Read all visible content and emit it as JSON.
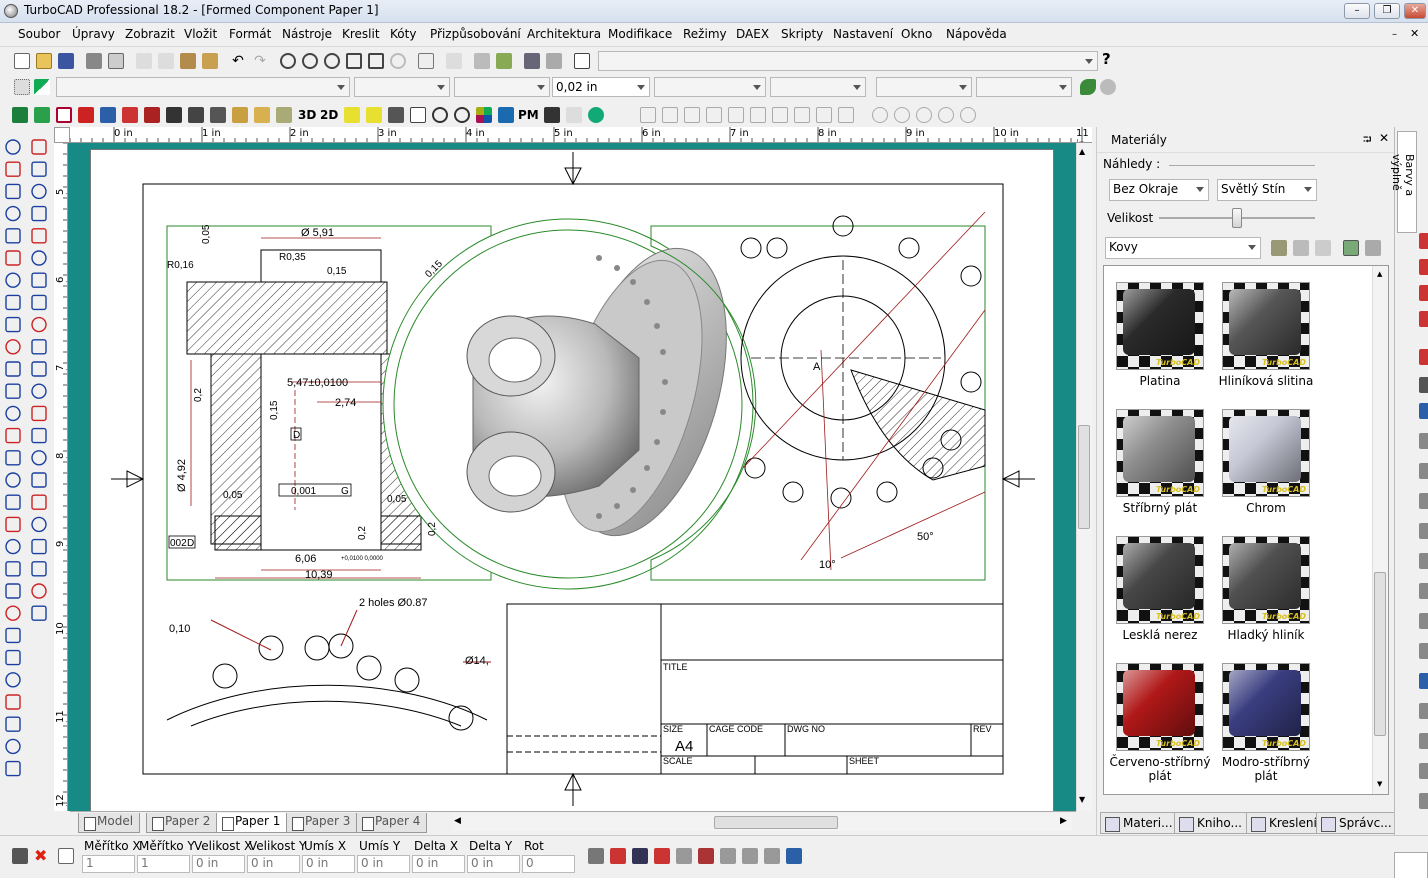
{
  "window": {
    "title": "TurboCAD Professional 18.2 - [Formed Component Paper 1]",
    "buttons": [
      "–",
      "❐",
      "✕"
    ]
  },
  "menu": [
    "Soubor",
    "Úpravy",
    "Zobrazit",
    "Vložit",
    "Formát",
    "Nástroje",
    "Kreslit",
    "Kóty",
    "Přizpůsobování",
    "Architektura",
    "Modifikace",
    "Režimy",
    "DAEX",
    "Skripty",
    "Nastavení",
    "Okno",
    "Nápověda"
  ],
  "toolbar": {
    "thickness_value": "0,02 in",
    "help_icon": "?"
  },
  "view_labels": {
    "three_d": "3D",
    "two_d": "2D",
    "pm": "PM"
  },
  "rulers": {
    "h": [
      "0 in",
      "1 in",
      "2 in",
      "3 in",
      "4 in",
      "5 in",
      "6 in",
      "7 in",
      "8 in",
      "9 in",
      "10 in",
      "11 in"
    ],
    "v": [
      "5 in",
      "6 in",
      "7 in",
      "8 in",
      "9 in",
      "10 in",
      "11 in",
      "12 in"
    ]
  },
  "drawing": {
    "dims": [
      "Ø 5,91",
      "R0,35",
      "0,15",
      "0,05",
      "R0,16",
      "5,47±0,0100",
      "2,74",
      "0,15",
      "0,2",
      "Ø 4,92",
      "0,05",
      "0,05",
      "0,2",
      "0,2",
      "6,06",
      "10,39",
      "2 holes Ø0.87",
      "Ø14,",
      "0,10",
      "50°",
      "10°",
      "A",
      "D",
      "0,001",
      "G",
      "002",
      "D",
      "0,15",
      "+0,0100 0,0000"
    ],
    "title_block": {
      "title": "TITLE",
      "size": "SIZE",
      "size_value": "A4",
      "cage": "CAGE CODE",
      "dwg": "DWG NO",
      "rev": "REV",
      "scale": "SCALE",
      "sheet": "SHEET"
    }
  },
  "tabs": [
    {
      "label": "Model",
      "active": false
    },
    {
      "label": "Paper 2",
      "active": false
    },
    {
      "label": "Paper 1",
      "active": true
    },
    {
      "label": "Paper 3",
      "active": false
    },
    {
      "label": "Paper 4",
      "active": false
    }
  ],
  "status": {
    "labels": [
      "Měřítko X",
      "Měřítko Y",
      "Velikost X",
      "Velikost Y",
      "Umís X",
      "Umís Y",
      "Delta X",
      "Delta Y",
      "Rot"
    ],
    "values": [
      "1",
      "1",
      "0 in",
      "0 in",
      "0 in",
      "0 in",
      "0 in",
      "0 in",
      "0"
    ]
  },
  "panel": {
    "title": "Materiály",
    "nahledy": "Náhledy :",
    "border_option": "Bez Okraje",
    "shade_option": "Světlý Stín",
    "size_label": "Velikost",
    "size_level": 0.5,
    "category": "Kovy",
    "materials": [
      {
        "name": "Platina",
        "color": "#2a2a2a",
        "rough": false
      },
      {
        "name": "Hliníková slitina",
        "color": "#5a5a5a",
        "rough": true
      },
      {
        "name": "Stříbrný plát",
        "color": "#8f8f8f",
        "rough": false
      },
      {
        "name": "Chrom",
        "color": "#c6c8d6",
        "rough": false
      },
      {
        "name": "Lesklá nerez",
        "color": "#474747",
        "rough": false
      },
      {
        "name": "Hladký hliník",
        "color": "#505050",
        "rough": false
      },
      {
        "name": "Červeno-stříbrný plát",
        "color": "#b01818",
        "rough": false
      },
      {
        "name": "Modro-stříbrný plát",
        "color": "#3a3e80",
        "rough": false
      }
    ],
    "watermark": "TurboCAD",
    "bottom_tabs": [
      "Materi...",
      "Kniho...",
      "Kreslení",
      "Správc..."
    ],
    "side_tab": "Barvy a výplně",
    "pin": "⮒",
    "close": "✕"
  }
}
